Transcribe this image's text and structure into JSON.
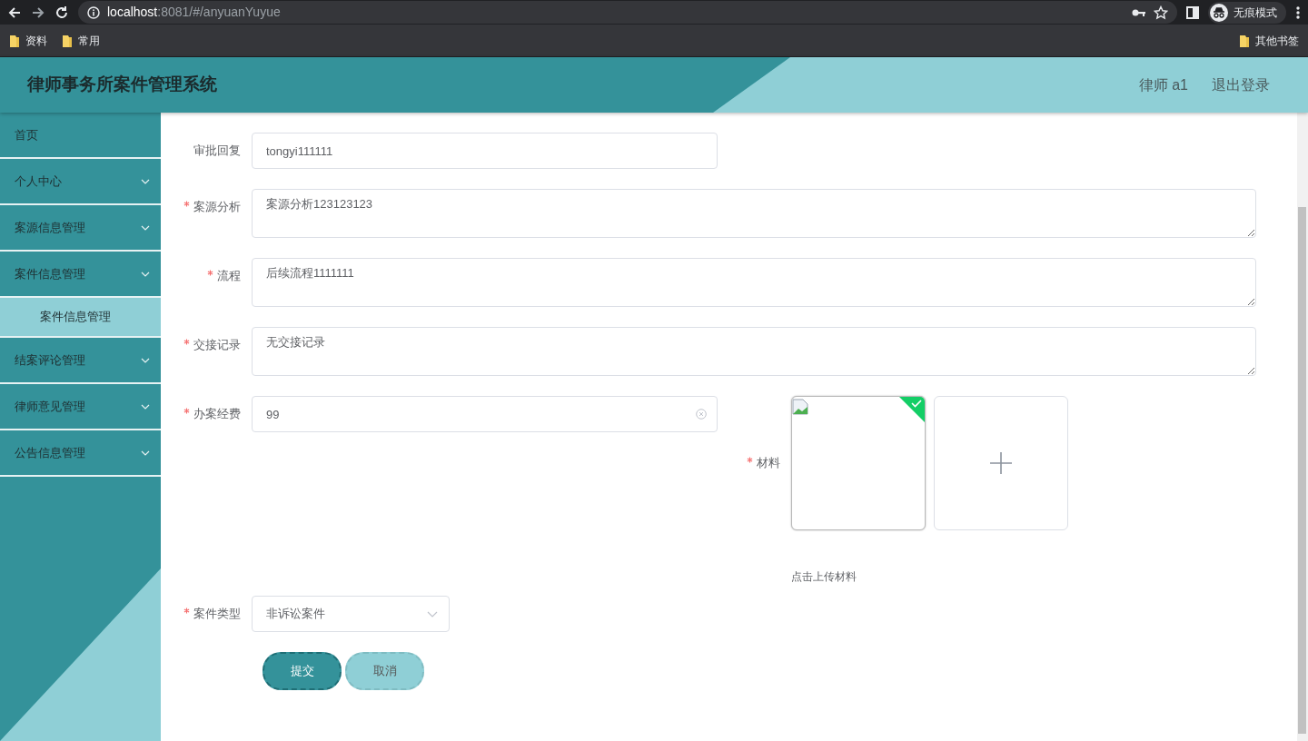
{
  "browser": {
    "url_host": "localhost",
    "url_path": ":8081/#/anyuanYuyue",
    "profile": "无痕模式",
    "bookmarks": [
      "资料",
      "常用"
    ],
    "other_bookmarks": "其他书签"
  },
  "header": {
    "title": "律师事务所案件管理系统",
    "user": "律师 a1",
    "logout": "退出登录"
  },
  "sidebar": {
    "items": [
      {
        "label": "首页",
        "kind": "link"
      },
      {
        "label": "个人中心",
        "kind": "menu"
      },
      {
        "label": "案源信息管理",
        "kind": "menu"
      },
      {
        "label": "案件信息管理",
        "kind": "menu",
        "children": [
          {
            "label": "案件信息管理",
            "selected": true
          }
        ]
      },
      {
        "label": "结案评论管理",
        "kind": "menu"
      },
      {
        "label": "律师意见管理",
        "kind": "menu"
      },
      {
        "label": "公告信息管理",
        "kind": "menu"
      }
    ]
  },
  "form": {
    "fields": [
      {
        "label": "审批回复",
        "kind": "input",
        "required": false,
        "value": "tongyi111111",
        "clearable": false
      },
      {
        "label": "案源分析",
        "kind": "textarea",
        "required": true,
        "value": "案源分析123123123",
        "clearable": false
      },
      {
        "label": "流程",
        "kind": "textarea",
        "required": true,
        "value": "后续流程1111111",
        "clearable": false
      },
      {
        "label": "交接记录",
        "kind": "textarea",
        "required": true,
        "value": "无交接记录",
        "clearable": false
      },
      {
        "label": "办案经费",
        "kind": "input",
        "required": true,
        "value": "99",
        "clearable": true
      }
    ],
    "upload": {
      "label": "材料",
      "required": true,
      "files": [
        {
          "uploaded": true
        }
      ],
      "hint": "点击上传材料"
    },
    "select": {
      "label": "案件类型",
      "required": true,
      "value": "非诉讼案件"
    },
    "buttons": [
      {
        "label": "提交",
        "kind": "primary"
      },
      {
        "label": "取消",
        "kind": "secondary"
      }
    ]
  }
}
